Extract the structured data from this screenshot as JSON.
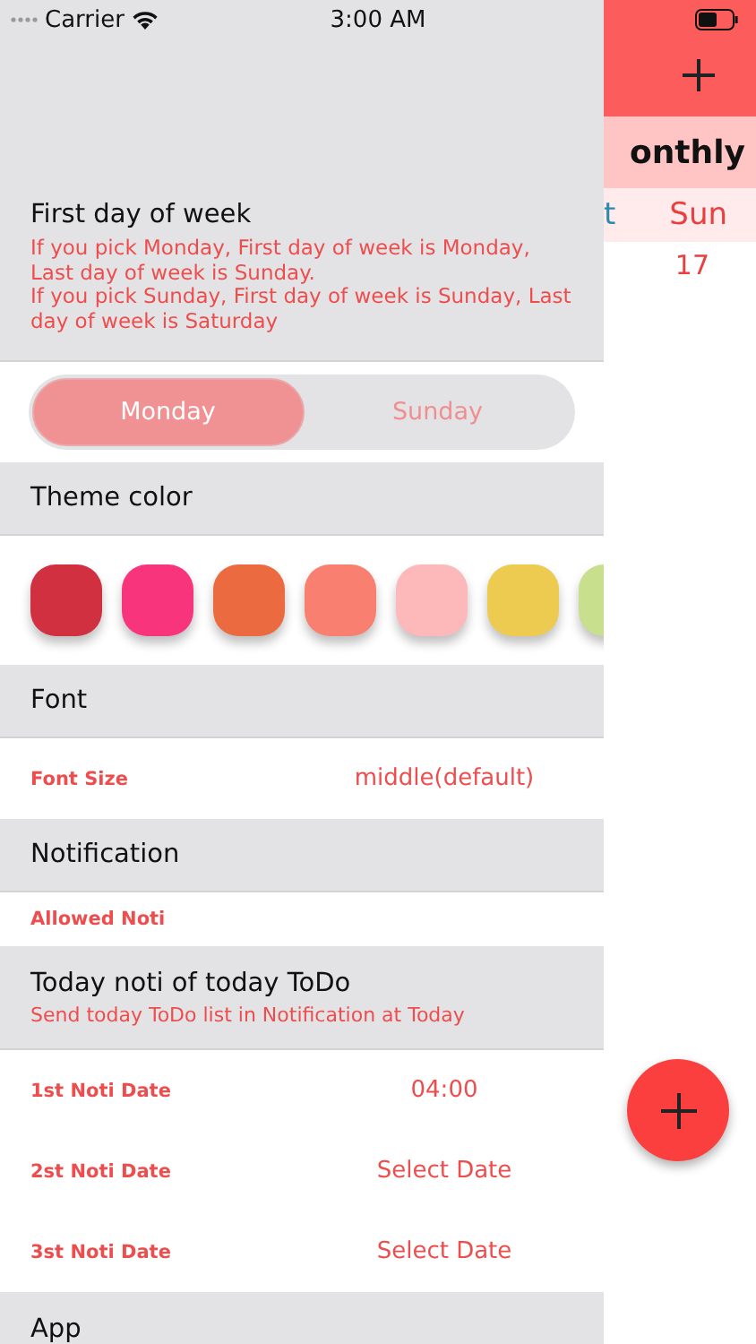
{
  "status_bar": {
    "carrier": "Carrier",
    "time": "3:00 AM"
  },
  "background": {
    "month_tab": "onthly",
    "weekday_headers": [
      {
        "label": "t",
        "kind": "sat"
      },
      {
        "label": "Sun",
        "kind": "sun"
      }
    ],
    "date_cells": [
      {
        "label": "17",
        "kind": "sun"
      }
    ]
  },
  "drawer": {
    "first_day": {
      "title": "First day of week",
      "description_lines": [
        "If you pick Monday, First day of week is Monday, Last day of week is Sunday.",
        "If you pick Sunday, First day of week is Sunday, Last day of week is Saturday"
      ],
      "options": [
        {
          "label": "Monday",
          "selected": true
        },
        {
          "label": "Sunday",
          "selected": false
        }
      ]
    },
    "theme_color": {
      "title": "Theme color",
      "swatches": [
        {
          "color": "#d0303f"
        },
        {
          "color": "#f7347c"
        },
        {
          "color": "#ec6a40"
        },
        {
          "color": "#f98070"
        },
        {
          "color": "#fdb8ba"
        },
        {
          "color": "#eccb50"
        },
        {
          "color": "#c8e08e"
        }
      ]
    },
    "font": {
      "title": "Font",
      "rows": [
        {
          "label": "Font Size",
          "value": "middle(default)"
        }
      ]
    },
    "notification": {
      "title": "Notification",
      "rows": [
        {
          "label": "Allowed Noti"
        }
      ]
    },
    "today_noti": {
      "title": "Today noti of today ToDo",
      "subtitle": "Send today ToDo list in Notification at Today",
      "rows": [
        {
          "label": "1st Noti Date",
          "value": "04:00"
        },
        {
          "label": "2st Noti Date",
          "value": "Select Date"
        },
        {
          "label": "3st Noti Date",
          "value": "Select Date"
        }
      ]
    },
    "app": {
      "title": "App"
    }
  }
}
